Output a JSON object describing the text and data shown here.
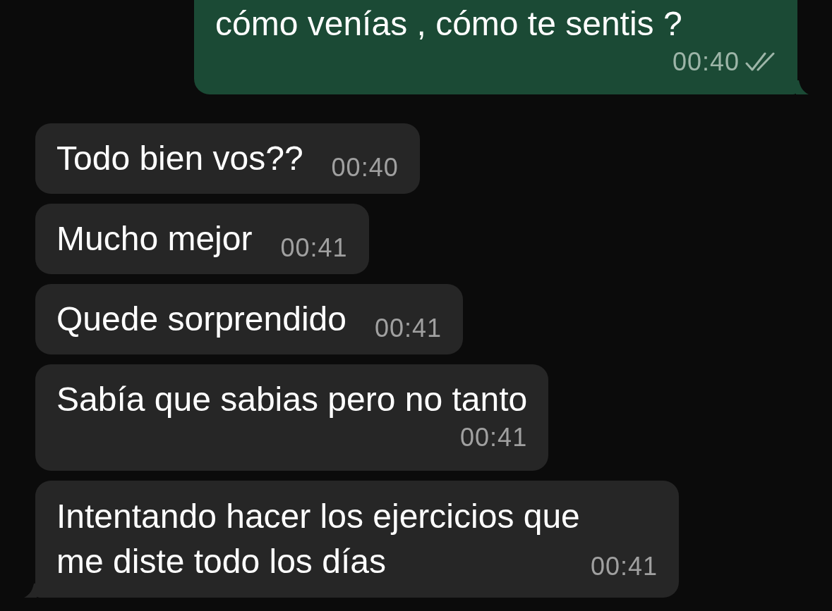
{
  "messages": [
    {
      "kind": "outgoing",
      "text": "cómo venías , cómo te sentis ?",
      "time": "00:40",
      "read": false,
      "tail": true
    },
    {
      "kind": "inline",
      "text": "Todo bien vos??",
      "time": "00:40",
      "tail": false
    },
    {
      "kind": "inline",
      "text": "Mucho mejor",
      "time": "00:41",
      "tail": false
    },
    {
      "kind": "inline",
      "text": "Quede sorprendido",
      "time": "00:41",
      "tail": false
    },
    {
      "kind": "stacked",
      "text": "Sabía que sabias pero no tanto",
      "time": "00:41",
      "tail": false
    },
    {
      "kind": "overlay",
      "text": "Intentando hacer los ejercicios que me diste todo los días",
      "time": "00:41",
      "tail": true
    }
  ]
}
